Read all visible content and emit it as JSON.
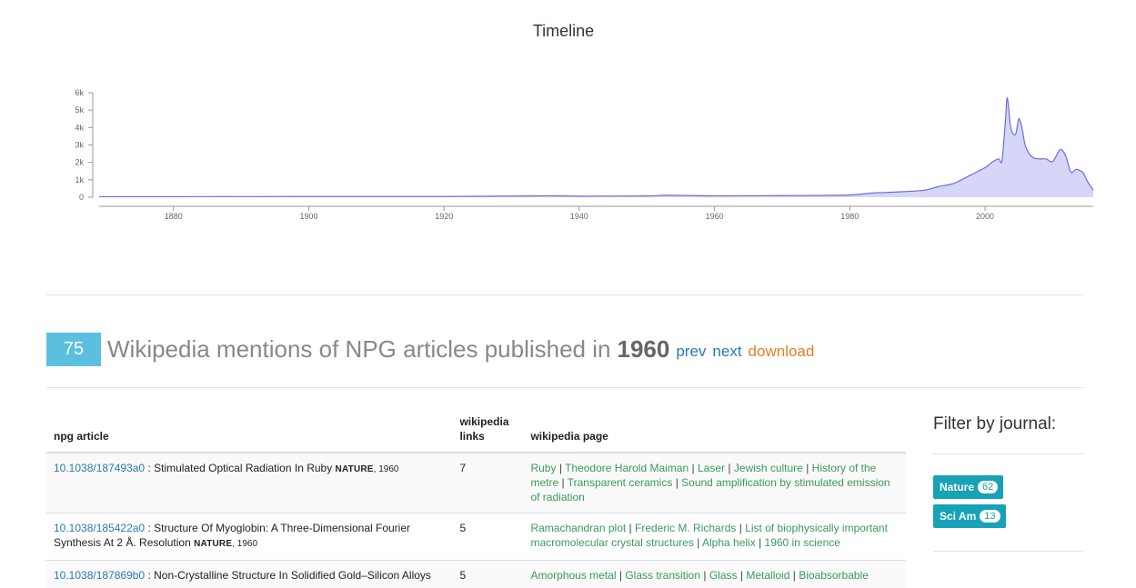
{
  "chart_data": {
    "type": "area",
    "title": "Timeline",
    "xlabel": "",
    "ylabel": "",
    "xlim": [
      1869,
      2016
    ],
    "ylim": [
      0,
      6000
    ],
    "y_ticks": [
      0,
      1000,
      2000,
      3000,
      4000,
      5000,
      6000
    ],
    "y_tick_labels": [
      "0",
      "1k",
      "2k",
      "3k",
      "4k",
      "5k",
      "6k"
    ],
    "x_ticks": [
      1880,
      1900,
      1920,
      1940,
      1960,
      1980,
      2000
    ],
    "x_tick_labels": [
      "1880",
      "1900",
      "1920",
      "1940",
      "1960",
      "1980",
      "2000"
    ],
    "grid": false,
    "legend": "none",
    "fill_color": "#d6d6f8",
    "line_color": "#6b6be6",
    "x": [
      1869,
      1880,
      1900,
      1920,
      1935,
      1940,
      1950,
      1953,
      1960,
      1970,
      1975,
      1980,
      1983,
      1985,
      1988,
      1991,
      1993,
      1995,
      1996,
      1998,
      2000,
      2001,
      2002,
      2002.5,
      2003,
      2003.3,
      2003.8,
      2004.5,
      2005,
      2005.5,
      2006,
      2007,
      2008,
      2009,
      2010,
      2011,
      2011.5,
      2012,
      2012.7,
      2013.5,
      2014.5,
      2015,
      2015.5,
      2016
    ],
    "y": [
      30,
      30,
      40,
      40,
      80,
      60,
      70,
      110,
      80,
      90,
      100,
      130,
      230,
      270,
      320,
      400,
      600,
      750,
      900,
      1300,
      1700,
      2000,
      2200,
      2100,
      4300,
      5700,
      4000,
      3600,
      4500,
      3900,
      2900,
      2300,
      2200,
      2200,
      2050,
      2700,
      2650,
      2300,
      1450,
      1600,
      1400,
      1000,
      700,
      400
    ]
  },
  "results": {
    "count": "75",
    "heading": "Wikipedia mentions of NPG articles published in",
    "year": "1960",
    "prev_label": "prev",
    "next_label": "next",
    "download_label": "download"
  },
  "table": {
    "headers": {
      "article": "npg article",
      "links": "wikipedia links",
      "pages": "wikipedia page"
    },
    "rows": [
      {
        "doi": "10.1038/187493a0",
        "title": " : Stimulated Optical Radiation In Ruby ",
        "journal": "Nature",
        "year": ", 1960",
        "links": "7",
        "pages": [
          "Ruby",
          "Theodore Harold Maiman",
          "Laser",
          "Jewish culture",
          "History of the metre",
          "Transparent ceramics",
          "Sound amplification by stimulated emission of radiation"
        ]
      },
      {
        "doi": "10.1038/185422a0",
        "title": " : Structure Of Myoglobin: A Three-Dimensional Fourier Synthesis At 2 Å. Resolution ",
        "journal": "Nature",
        "year": ", 1960",
        "links": "5",
        "pages": [
          "Ramachandran plot",
          "Frederic M. Richards",
          "List of biophysically important macromolecular crystal structures",
          "Alpha helix",
          "1960 in science"
        ]
      },
      {
        "doi": "10.1038/187869b0",
        "title": " : Non-Crystalline Structure In Solidified Gold–Silicon Alloys",
        "journal": "",
        "year": "",
        "links": "5",
        "pages": [
          "Amorphous metal",
          "Glass transition",
          "Glass",
          "Metalloid",
          "Bioabsorbable"
        ]
      }
    ]
  },
  "sidebar": {
    "title": "Filter by journal:",
    "journals": [
      {
        "name": "Nature",
        "count": "62"
      },
      {
        "name": "Sci Am",
        "count": "13"
      }
    ]
  }
}
